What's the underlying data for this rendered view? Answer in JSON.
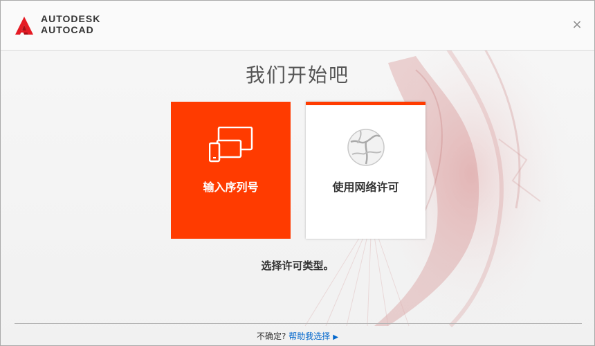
{
  "header": {
    "brand_line1": "AUTODESK",
    "brand_line2": "AUTOCAD",
    "close_symbol": "×"
  },
  "main": {
    "title": "我们开始吧",
    "cards": [
      {
        "label": "输入序列号",
        "icon": "devices-icon",
        "state": "selected"
      },
      {
        "label": "使用网络许可",
        "icon": "network-globe-icon",
        "state": "default"
      }
    ],
    "hint": "选择许可类型。"
  },
  "footer": {
    "question": "不确定?",
    "help_link": "帮助我选择"
  },
  "colors": {
    "accent": "#ff3b00",
    "link": "#0066cc",
    "text": "#333333",
    "title_text": "#555555"
  }
}
